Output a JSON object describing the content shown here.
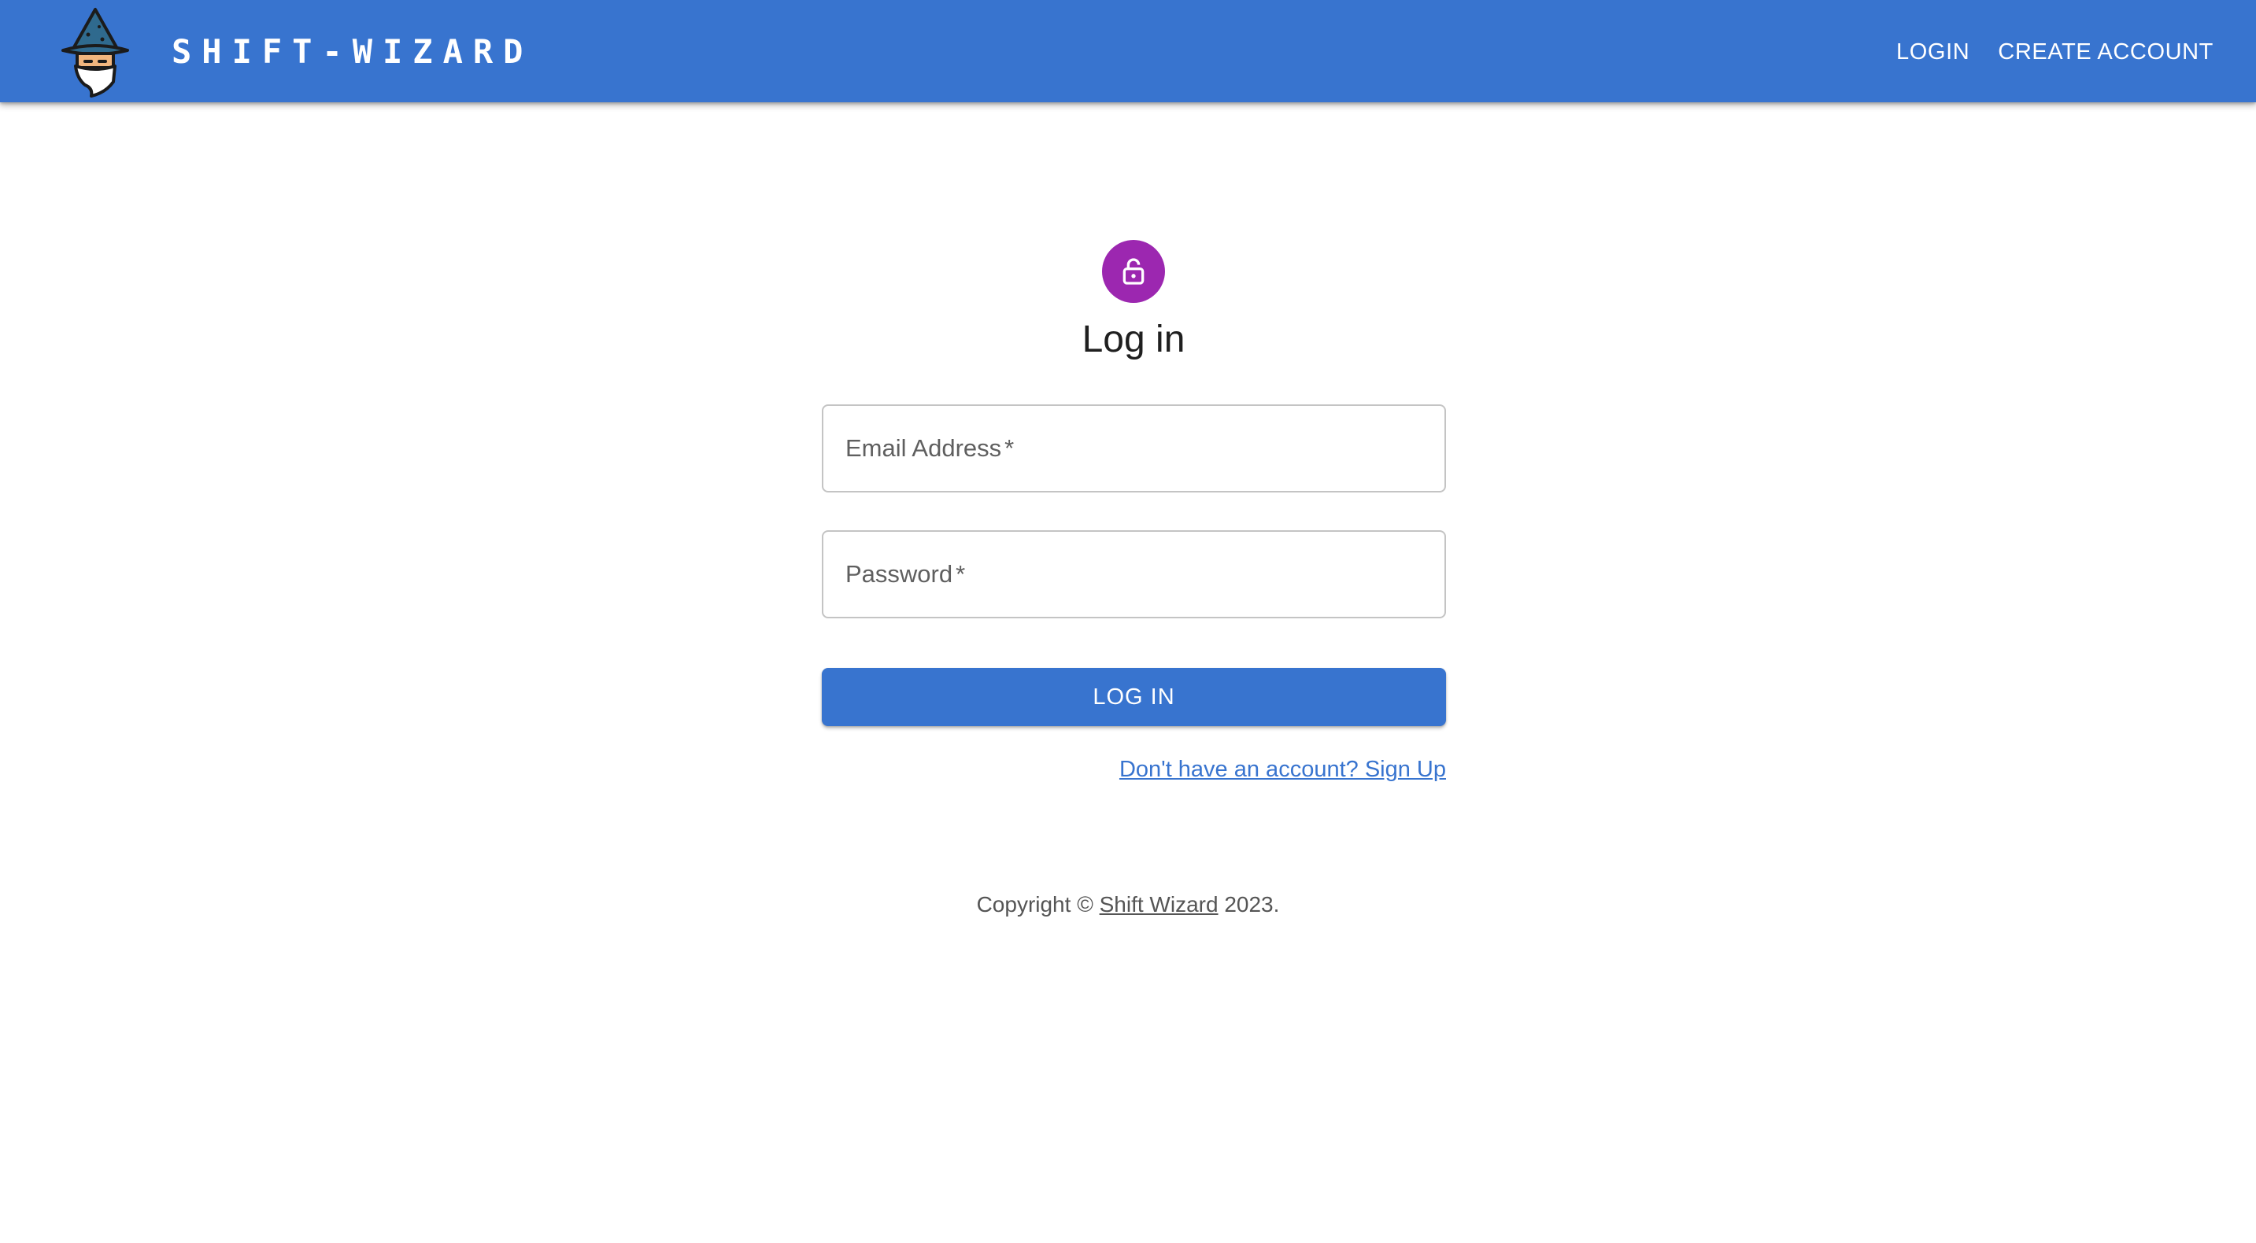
{
  "header": {
    "brand": "SHIFT-WIZARD",
    "logo_icon": "wizard-icon",
    "nav": [
      {
        "label": "LOGIN"
      },
      {
        "label": "CREATE ACCOUNT"
      }
    ]
  },
  "form": {
    "icon": "lock-icon",
    "title": "Log in",
    "email": {
      "label": "Email Address",
      "required_mark": "*",
      "value": ""
    },
    "password": {
      "label": "Password",
      "required_mark": "*",
      "value": ""
    },
    "submit_label": "LOG IN",
    "signup_link": "Don't have an account? Sign Up"
  },
  "footer": {
    "prefix": "Copyright © ",
    "link": "Shift Wizard",
    "suffix": " 2023."
  },
  "colors": {
    "primary": "#3874cf",
    "avatar": "#9c27b0",
    "text": "#1f1f1f",
    "muted": "#555555"
  }
}
